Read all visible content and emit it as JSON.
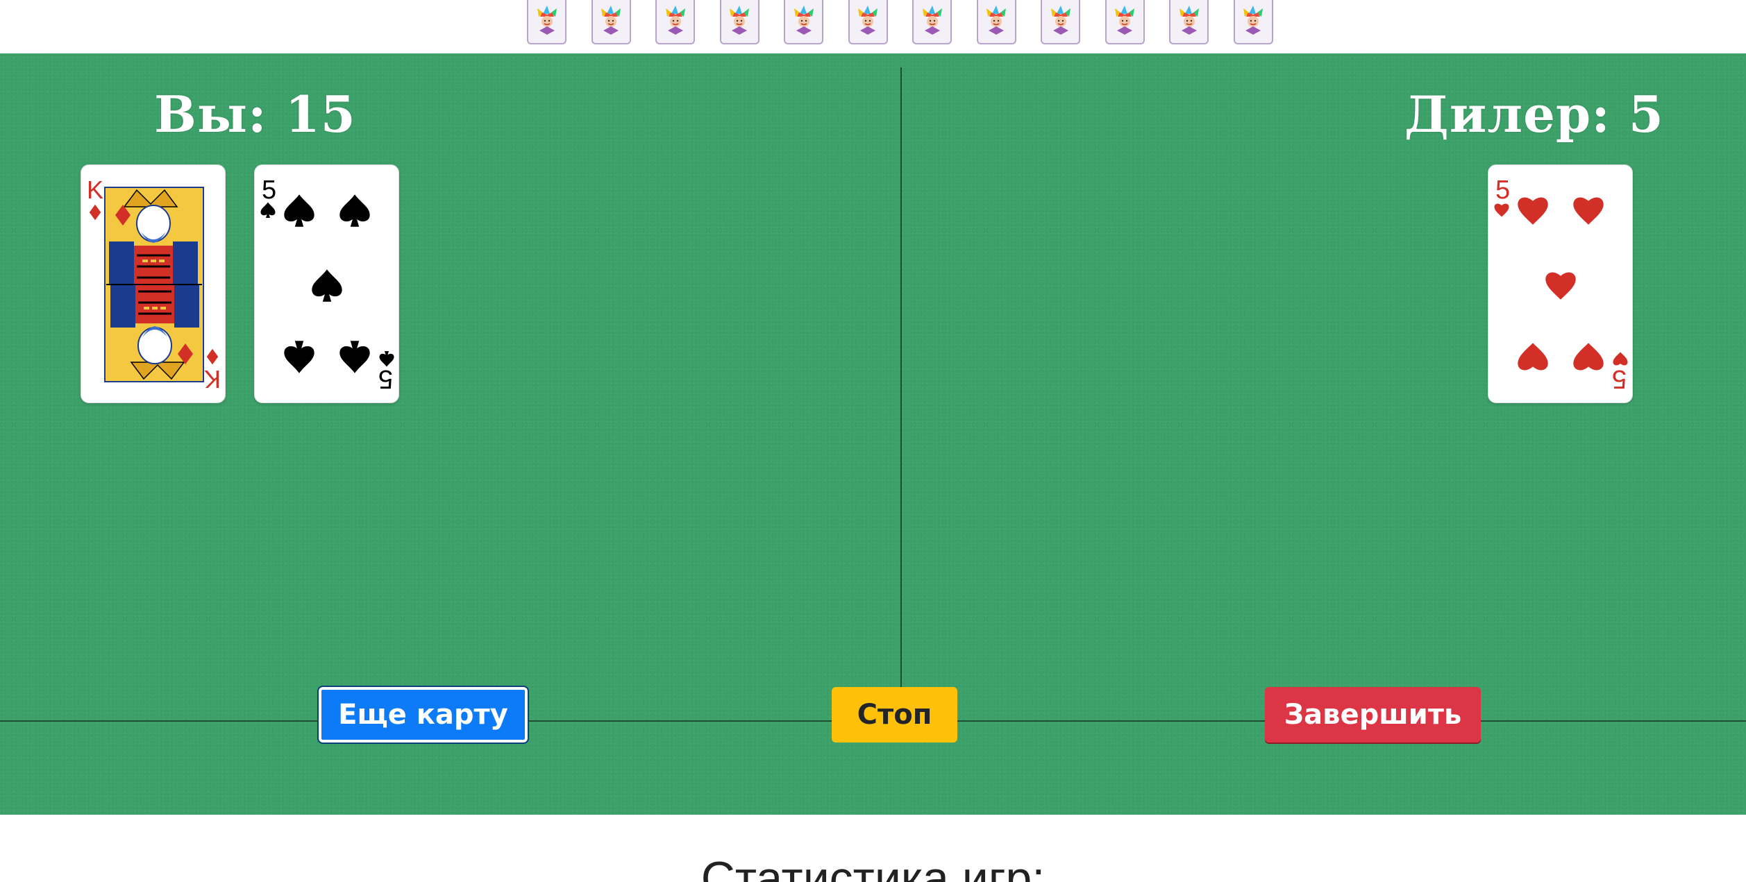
{
  "deck": {
    "count": 12,
    "back_icon": "jester-icon"
  },
  "player": {
    "label": "Вы",
    "score": "15",
    "cards": [
      {
        "rank": "K",
        "suit": "diamonds",
        "color": "#d22f27",
        "face": true
      },
      {
        "rank": "5",
        "suit": "spades",
        "color": "#000000",
        "face": false
      }
    ]
  },
  "dealer": {
    "label": "Дилер",
    "score": "5",
    "cards": [
      {
        "rank": "5",
        "suit": "hearts",
        "color": "#d22f27",
        "face": false
      }
    ]
  },
  "buttons": {
    "hit": "Еще карту",
    "stand": "Стоп",
    "finish": "Завершить"
  },
  "stats": {
    "title": "Статистика игр:"
  },
  "colors": {
    "table": "#3da26a",
    "hit": "#0d7bf8",
    "stand": "#ffc107",
    "finish": "#dc3545"
  }
}
